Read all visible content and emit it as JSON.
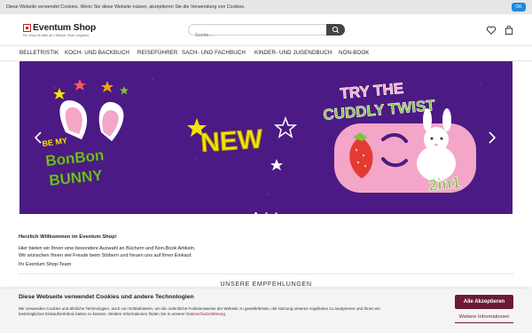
{
  "cookie_bar_top": {
    "text": "Diese Website verwendet Cookies. Wenn Sie diese Website nutzen, akzeptieren Sie die Verwendung von Cookies.",
    "ok_label": "OK"
  },
  "header": {
    "logo_text": "Eventum Shop",
    "logo_tagline": "Ein Shop für alles ab 1 Bücher, Buch. Angebot.",
    "search_placeholder": "Suche...",
    "icons": [
      "search-icon",
      "heart-icon",
      "bag-icon"
    ]
  },
  "nav": {
    "items": [
      "BELLETRISTIK",
      "KOCH- UND BACKBUCH",
      "REISEFÜHRER",
      "SACH- UND FACHBUCH",
      "KINDER- UND JUGENDBUCH",
      "NON-BOOK"
    ]
  },
  "banner": {
    "left_text_top": "BE MY",
    "left_text_mid": "BonBon",
    "left_text_bottom": "BUNNY",
    "center_text": "NEW",
    "right_title_line1": "TRY THE",
    "right_title_line2": "CUDDLY TWIST",
    "right_badge": "2in1",
    "colors": {
      "background": "#4b1a84",
      "yellow": "#f5e400",
      "green": "#7dc33b",
      "pink": "#f3a6c8"
    }
  },
  "welcome": {
    "title": "Herzlich Willkommen im Eventum Shop!",
    "line1": "Hier bieten wir Ihnen eine besondere Auswahl an Büchern und Non-Book Artikeln.",
    "line2": "Wir wünschen Ihnen viel Freude beim Stöbern und freuen uns auf Ihren Einkauf.",
    "signature": "Ihr Eventum Shop-Team"
  },
  "section": {
    "title": "UNSERE EMPFEHLUNGEN"
  },
  "cookie_dialog": {
    "heading": "Diese Webseite verwendet Cookies und andere Technologien",
    "text": "Wir verwenden Cookies und ähnliche Technologien, auch von Drittanbietern, um die ordentliche Funktionsweise der Website zu gewährleisten, die Nutzung unseres Angebotes zu analysieren und Ihnen ein bestmögliches Einkaufserlebnis bieten zu können. Weitere Informationen finden Sie in unserer",
    "link_text": "Datenschutzerklärung",
    "accept_label": "Alle Akzeptieren",
    "more_label": "Weitere Informationen"
  }
}
